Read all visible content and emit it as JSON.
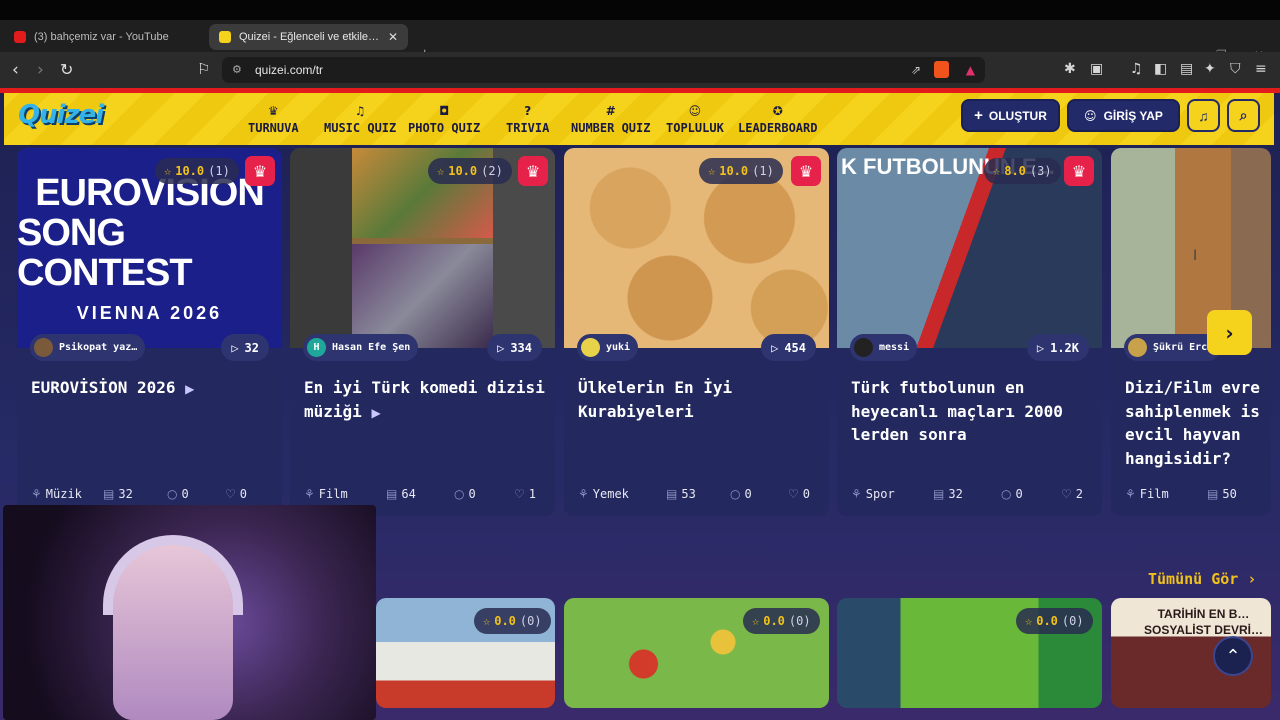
{
  "browser": {
    "tabs": [
      {
        "title": "(3) bahçemiz var - YouTube",
        "active": false
      },
      {
        "title": "Quizei - Eğlenceli ve etkileşimli quiz",
        "active": true
      }
    ],
    "url": "quizei.com/tr",
    "new_tab_icon": "plus-icon"
  },
  "site": {
    "logo": "Quizei",
    "menu": [
      {
        "label": "TURNUVA",
        "icon": "trophy-icon",
        "glyph": "♛"
      },
      {
        "label": "MUSIC QUIZ",
        "icon": "music-icon",
        "glyph": "♫"
      },
      {
        "label": "PHOTO QUIZ",
        "icon": "camera-icon",
        "glyph": "◘"
      },
      {
        "label": "TRIVIA",
        "icon": "question-icon",
        "glyph": "?"
      },
      {
        "label": "NUMBER QUIZ",
        "icon": "hash-icon",
        "glyph": "#"
      },
      {
        "label": "TOPLULUK",
        "icon": "users-icon",
        "glyph": "☺"
      },
      {
        "label": "LEADERBOARD",
        "icon": "medal-icon",
        "glyph": "✪"
      }
    ],
    "create_label": "OLUŞTUR",
    "login_label": "GİRİŞ YAP",
    "see_all": "Tümünü Gör ›"
  },
  "cards": [
    {
      "rating": "10.0",
      "rating_count": "(1)",
      "author": "Psikopat yaz…",
      "plays": "32",
      "title": "EUROVİSİON 2026",
      "video": true,
      "category": "Müzik",
      "questions": "32",
      "comments": "0",
      "likes": "0",
      "thumb_text": "EUROVISION SONG CONTEST VIENNA 2026"
    },
    {
      "rating": "10.0",
      "rating_count": "(2)",
      "author": "Hasan Efe Şen",
      "plays": "334",
      "title": "En iyi Türk komedi dizisi müziği",
      "video": true,
      "category": "Film",
      "questions": "64",
      "comments": "0",
      "likes": "1"
    },
    {
      "rating": "10.0",
      "rating_count": "(1)",
      "author": "yuki",
      "plays": "454",
      "title": "Ülkelerin En İyi Kurabiyeleri",
      "video": false,
      "category": "Yemek",
      "questions": "53",
      "comments": "0",
      "likes": "0"
    },
    {
      "rating": "8.0",
      "rating_count": "(3)",
      "author": "messi",
      "plays": "1.2K",
      "title": "Türk futbolunun en heyecanlı maçları 2000 lerden sonra",
      "video": false,
      "category": "Spor",
      "questions": "32",
      "comments": "0",
      "likes": "2",
      "thumb_text": "K FUTBOLUNUN E..."
    },
    {
      "rating": "",
      "rating_count": "",
      "author": "Şükrü Erc…",
      "plays": "",
      "title": "Dizi/Film evre sahiplenmek is evcil hayvan hangisidir?",
      "video": false,
      "category": "Film",
      "questions": "50",
      "comments": "",
      "likes": ""
    }
  ],
  "row2": [
    {
      "rating": "0.0",
      "rating_count": "(0)"
    },
    {
      "rating": "0.0",
      "rating_count": "(0)"
    },
    {
      "rating": "0.0",
      "rating_count": "(0)"
    },
    {
      "thumb_text": "TARİHİN EN B… SOSYALİST DEVRİ…"
    }
  ]
}
